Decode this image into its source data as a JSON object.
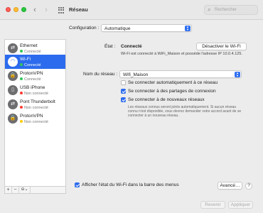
{
  "window": {
    "title": "Réseau",
    "search_placeholder": "Rechercher"
  },
  "configuration": {
    "label": "Configuration :",
    "value": "Automatique"
  },
  "services": [
    {
      "name": "Ethernet",
      "status": "Connecté",
      "status_color": "#34c759",
      "icon": "ethernet-icon",
      "glyph": "⇄",
      "selected": false
    },
    {
      "name": "Wi-Fi",
      "status": "Connecté",
      "status_color": "#34c759",
      "icon": "wifi-icon",
      "glyph": "◠",
      "selected": true
    },
    {
      "name": "ProtonVPN",
      "status": "Connecté",
      "status_color": "#34c759",
      "icon": "vpn-icon",
      "glyph": "🔒",
      "selected": false
    },
    {
      "name": "USB iPhone",
      "status": "Non connecté",
      "status_color": "#ff3b30",
      "icon": "iphone-icon",
      "glyph": "▯",
      "selected": false
    },
    {
      "name": "Pont Thunderbolt",
      "status": "Non connecté",
      "status_color": "#ff3b30",
      "icon": "thunderbolt-icon",
      "glyph": "⇄",
      "selected": false
    },
    {
      "name": "ProtonVPN",
      "status": "Non connecté",
      "status_color": "#ffcc00",
      "icon": "vpn-icon",
      "glyph": "🔒",
      "selected": false
    }
  ],
  "sidebar_controls": {
    "add": "+",
    "remove": "−",
    "action": "⊖⌄"
  },
  "detail": {
    "state_label": "État :",
    "state_value": "Connecté",
    "turn_off_button": "Désactiver le Wi-Fi",
    "state_description": "Wi-Fi est connecté à WiFi_Maison et possède l'adresse IP 10.0.4.125.",
    "network_name_label": "Nom du réseau :",
    "network_name_value": "Wifi_Maison",
    "checkboxes": [
      {
        "label": "Se connecter automatiquement à ce réseau",
        "checked": false
      },
      {
        "label": "Se connecter à des partages de connexion",
        "checked": true
      },
      {
        "label": "Se connecter à de nouveaux réseaux",
        "checked": true
      }
    ],
    "hint": "Les réseaux connus seront joints automatiquement. Si aucun réseau connu n'est disponible, vous devrez demander votre accord avant de se connecter à un nouveau réseau.",
    "show_in_menu_label": "Afficher l'état du Wi-Fi dans la barre des menus",
    "show_in_menu_checked": true,
    "advanced_button": "Avancé…",
    "help_button": "?"
  },
  "footer": {
    "revert_button": "Revenir",
    "apply_button": "Appliquer"
  },
  "colors": {
    "accent": "#2c6bed",
    "connected": "#34c759",
    "disconnected": "#ff3b30",
    "inactive": "#ffcc00"
  }
}
